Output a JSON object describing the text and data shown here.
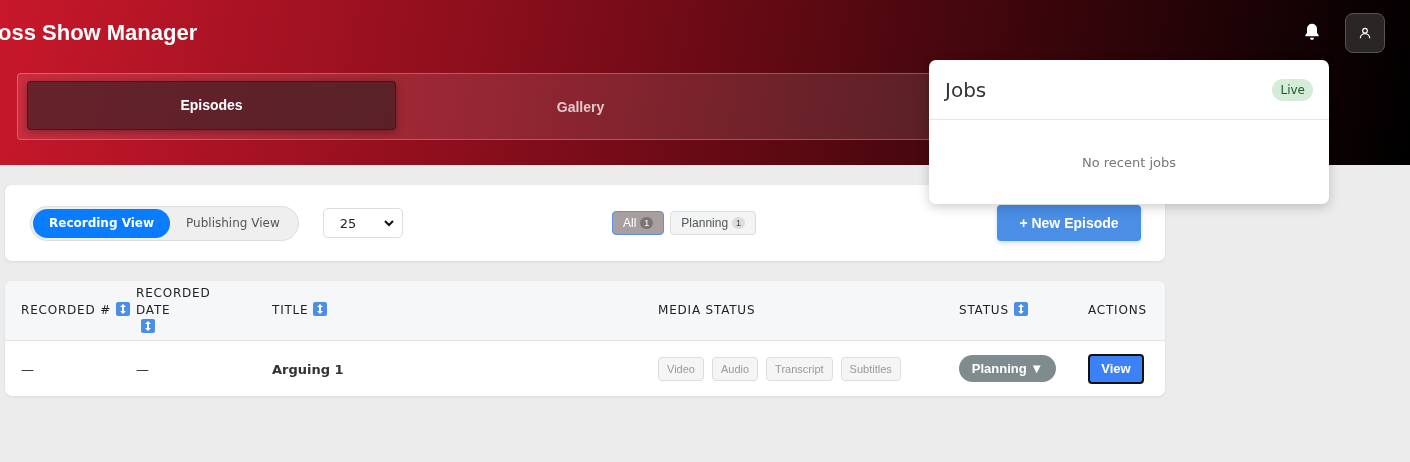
{
  "header": {
    "title": "oss Show Manager"
  },
  "tabs": [
    {
      "label": "Episodes",
      "selected": true
    },
    {
      "label": "Gallery",
      "selected": false
    }
  ],
  "jobs_popover": {
    "title": "Jobs",
    "badge": "Live",
    "empty_text": "No recent jobs"
  },
  "toolbar": {
    "views": [
      {
        "label": "Recording View",
        "selected": true
      },
      {
        "label": "Publishing View",
        "selected": false
      }
    ],
    "page_size": "25",
    "filters": [
      {
        "label": "All",
        "count": "1",
        "selected": true
      },
      {
        "label": "Planning",
        "count": "1",
        "selected": false
      }
    ],
    "new_button": "+ New Episode"
  },
  "table": {
    "columns": [
      {
        "label": "RECORDED #",
        "sortable": true
      },
      {
        "label": "RECORDED DATE",
        "sortable": true
      },
      {
        "label": "TITLE",
        "sortable": true
      },
      {
        "label": "MEDIA STATUS",
        "sortable": false
      },
      {
        "label": "STATUS",
        "sortable": true
      },
      {
        "label": "ACTIONS",
        "sortable": false
      }
    ],
    "rows": [
      {
        "recorded_number": "—",
        "recorded_date": "—",
        "title": "Arguing 1",
        "media": [
          "Video",
          "Audio",
          "Transcript",
          "Subtitles"
        ],
        "status": "Planning ▼",
        "action": "View"
      }
    ]
  }
}
